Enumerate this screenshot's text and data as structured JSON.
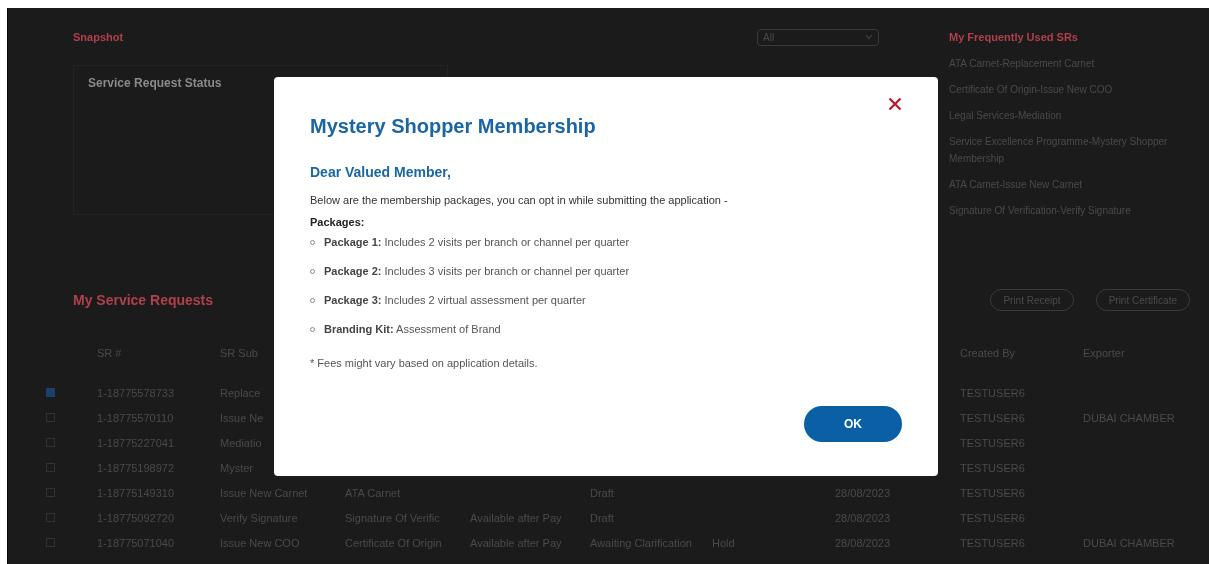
{
  "snapshot": {
    "title": "Snapshot",
    "filter": {
      "value": "All"
    },
    "status_card": {
      "title": "Service Request Status"
    }
  },
  "frequent_srs": {
    "title": "My Frequently Used SRs",
    "items": [
      {
        "label": "ATA Carnet-Replacement Carnet"
      },
      {
        "label": "Certificate Of Origin-Issue New COO"
      },
      {
        "label": "Legal Services-Mediation"
      },
      {
        "label": "Service Excellence Programme-Mystery Shopper Membership"
      },
      {
        "label": "ATA Carnet-Issue New Carnet"
      },
      {
        "label": "Signature Of Verification-Verify Signature"
      }
    ]
  },
  "service_requests": {
    "title": "My Service Requests",
    "buttons": [
      "Print Receipt",
      "Print Certificate"
    ],
    "columns": [
      "SR #",
      "SR Sub",
      null,
      null,
      null,
      null,
      null,
      "Created By",
      "Exporter"
    ],
    "rows": [
      {
        "checked": true,
        "cells": [
          "1-18775578733",
          "Replace",
          null,
          null,
          null,
          null,
          null,
          "TESTUSER6",
          null
        ]
      },
      {
        "checked": false,
        "cells": [
          "1-18775570110",
          "Issue Ne",
          null,
          null,
          null,
          null,
          null,
          "TESTUSER6",
          "DUBAI CHAMBER"
        ]
      },
      {
        "checked": false,
        "cells": [
          "1-18775227041",
          "Mediatio",
          null,
          null,
          null,
          null,
          null,
          "TESTUSER6",
          null
        ]
      },
      {
        "checked": false,
        "cells": [
          "1-18775198972",
          "Myster",
          null,
          null,
          null,
          null,
          null,
          "TESTUSER6",
          null
        ]
      },
      {
        "checked": false,
        "cells": [
          "1-18775149310",
          "Issue New Carnet",
          "ATA Carnet",
          null,
          "Draft",
          null,
          "28/08/2023",
          "TESTUSER6",
          null
        ]
      },
      {
        "checked": false,
        "cells": [
          "1-18775092720",
          "Verify Signature",
          "Signature Of Verific",
          "Available after Pay",
          "Draft",
          null,
          "28/08/2023",
          "TESTUSER6",
          null
        ]
      },
      {
        "checked": false,
        "cells": [
          "1-18775071040",
          "Issue New COO",
          "Certificate Of Origin",
          "Available after Pay",
          "Awaiting Clarification",
          "Hold",
          "28/08/2023",
          "TESTUSER6",
          "DUBAI CHAMBER"
        ]
      }
    ]
  },
  "dialog": {
    "title": "Mystery Shopper Membership",
    "greeting": "Dear Valued Member,",
    "intro": "Below are the membership packages, you can opt in while submitting the application -",
    "packages_label": "Packages:",
    "packages": [
      {
        "text": "**Package 1:** Includes 2 visits per branch or channel per quarter"
      },
      {
        "text": "**Package 2:** Includes 3 visits per branch or channel per quarter"
      },
      {
        "text": "**Package 3:** Includes 2 virtual assessment per quarter"
      },
      {
        "text": "**Branding Kit:** Assessment of Brand"
      }
    ],
    "note": "* Fees might vary based on application details.",
    "button": "OK"
  }
}
